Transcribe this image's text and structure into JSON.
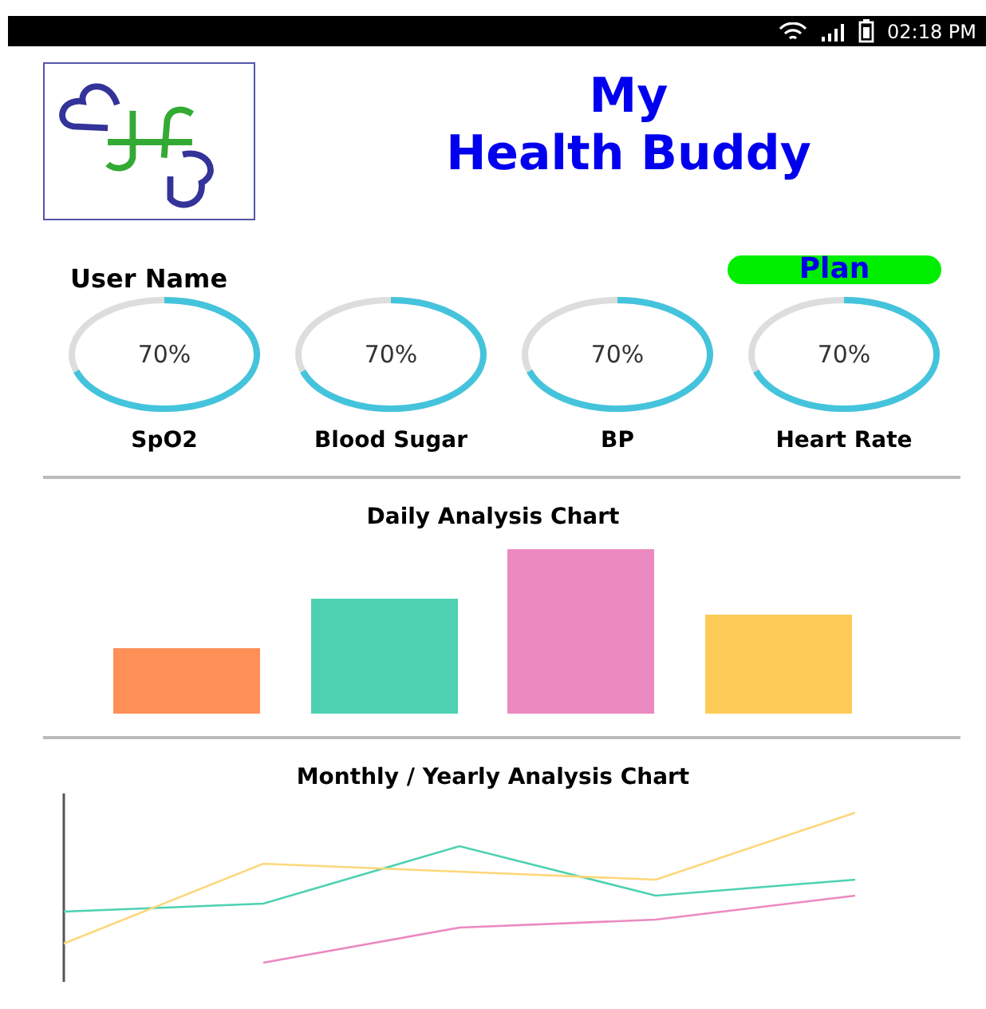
{
  "status_bar": {
    "time": "02:18 PM"
  },
  "header": {
    "title_lines": [
      "My",
      "Health Buddy"
    ]
  },
  "user": {
    "name": "User Name",
    "plan_button": "Plan"
  },
  "gauges": [
    {
      "label": "SpO2",
      "reading": "70%"
    },
    {
      "label": "Blood Sugar",
      "reading": "70%"
    },
    {
      "label": "BP",
      "reading": "70%"
    },
    {
      "label": "Heart Rate",
      "reading": "70%"
    }
  ],
  "daily_chart": {
    "title": "Daily Analysis Chart"
  },
  "monthly_chart": {
    "title": "Monthly / Yearly Analysis Chart"
  }
}
